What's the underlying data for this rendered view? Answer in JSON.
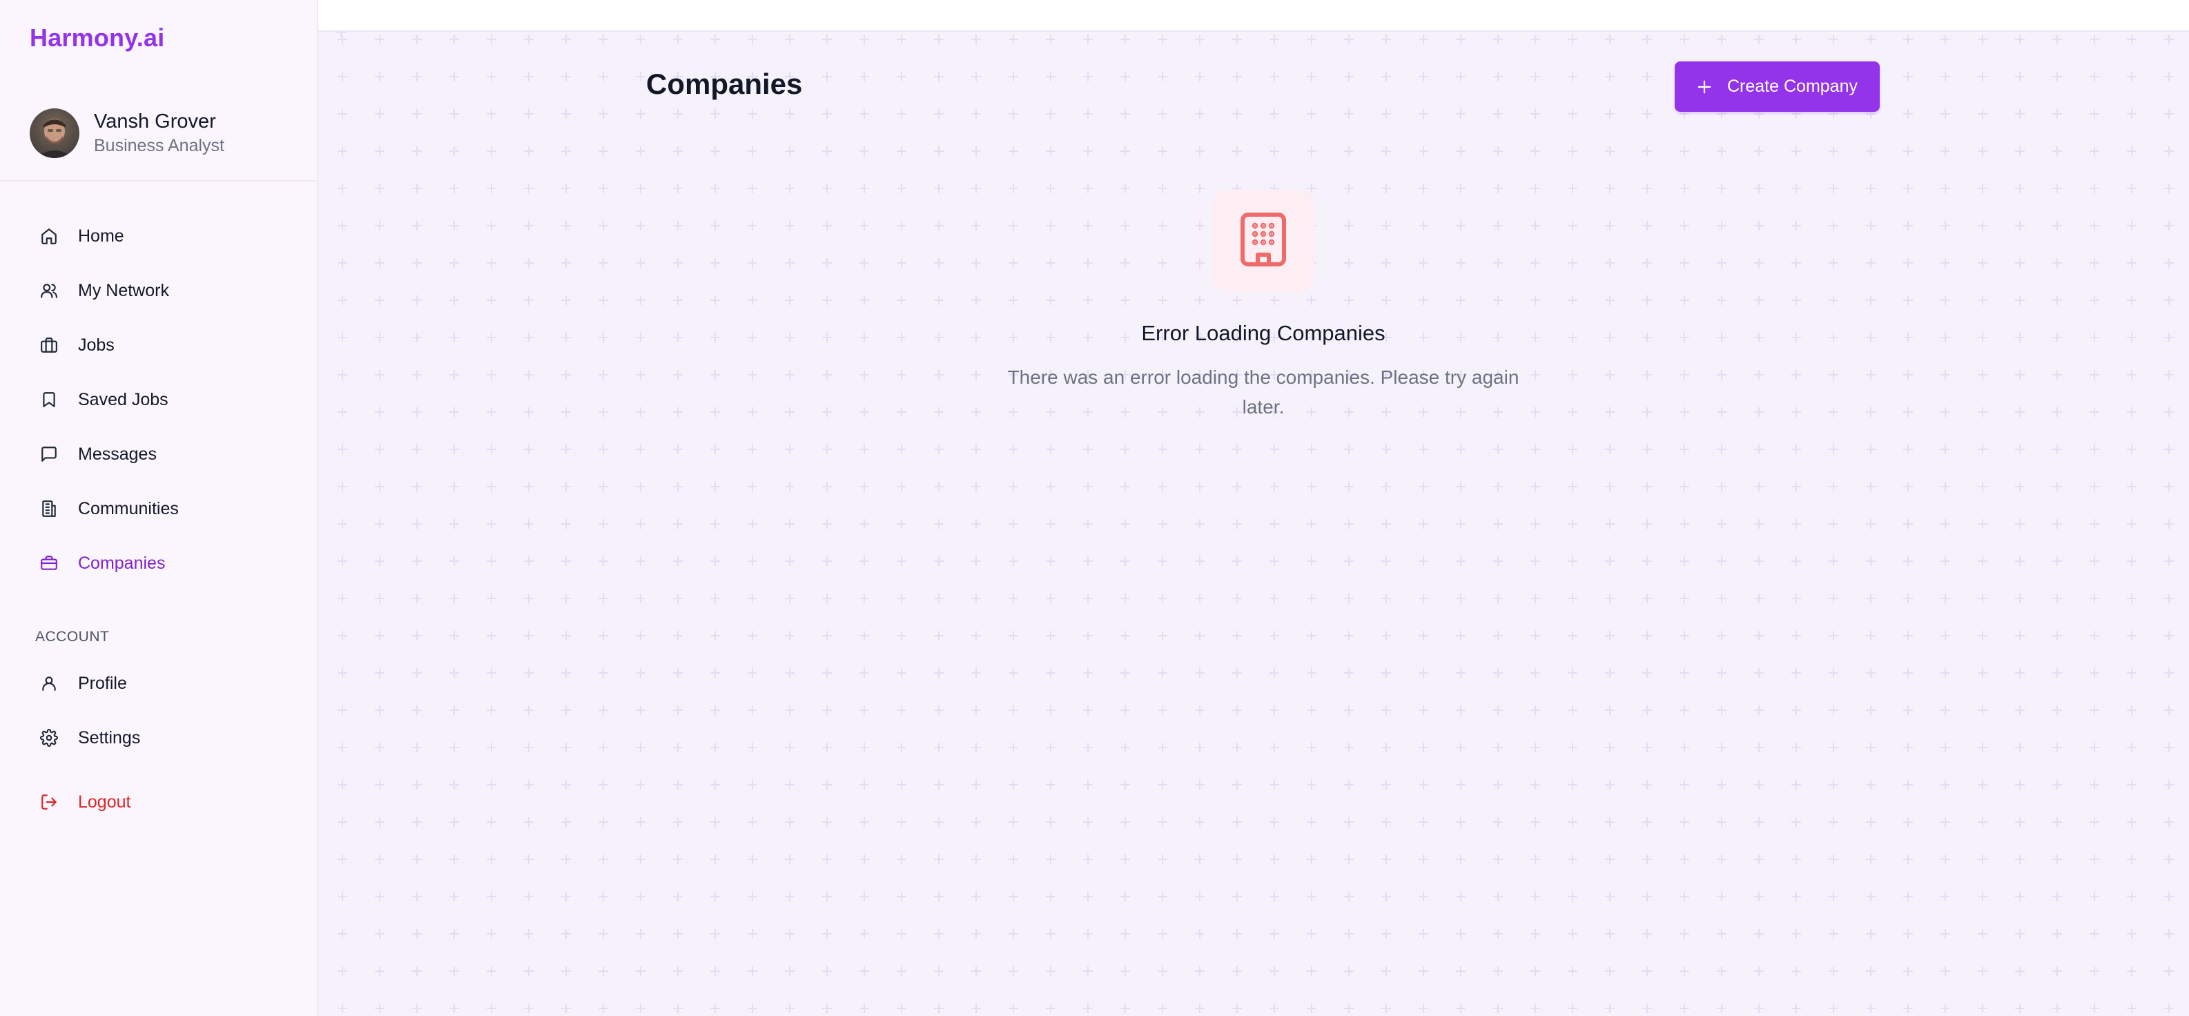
{
  "brand": {
    "name": "Harmony.ai",
    "color": "#9333ea"
  },
  "user": {
    "name": "Vansh Grover",
    "role": "Business Analyst"
  },
  "nav": {
    "items": [
      {
        "label": "Home",
        "icon": "home-icon"
      },
      {
        "label": "My Network",
        "icon": "users-icon"
      },
      {
        "label": "Jobs",
        "icon": "briefcase-icon"
      },
      {
        "label": "Saved Jobs",
        "icon": "bookmark-icon"
      },
      {
        "label": "Messages",
        "icon": "message-icon"
      },
      {
        "label": "Communities",
        "icon": "building-icon"
      },
      {
        "label": "Companies",
        "icon": "company-icon",
        "active": true
      }
    ],
    "account_label": "ACCOUNT",
    "account_items": [
      {
        "label": "Profile",
        "icon": "user-icon"
      },
      {
        "label": "Settings",
        "icon": "gear-icon"
      }
    ],
    "logout_label": "Logout"
  },
  "main": {
    "title": "Companies",
    "create_button_label": "Create Company",
    "error": {
      "icon": "building-icon",
      "title": "Error Loading Companies",
      "message": "There was an error loading the companies. Please try again later."
    }
  },
  "colors": {
    "accent": "#9333ea",
    "active_nav": "#7e22ce",
    "danger": "#dc2626",
    "error_icon": "#ef6b6b",
    "error_icon_bg": "#fceef2"
  }
}
